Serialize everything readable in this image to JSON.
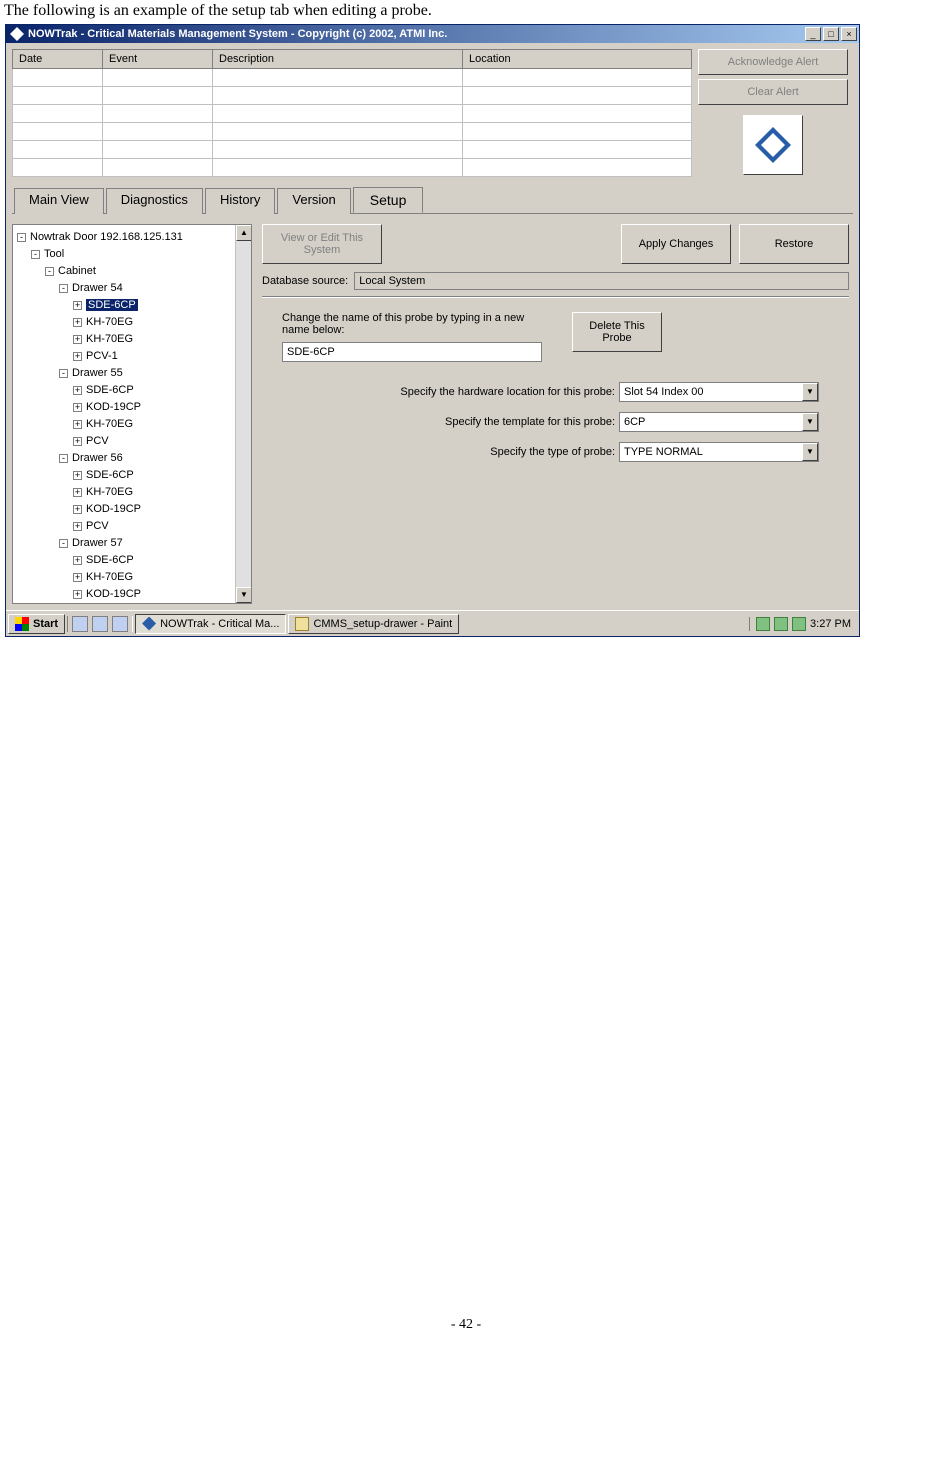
{
  "doc_caption": "The following is an example of the setup tab when editing a probe.",
  "window_title": "NOWTrak - Critical Materials Management System - Copyright (c) 2002, ATMI Inc.",
  "alert_cols": {
    "c1": "Date",
    "c2": "Event",
    "c3": "Description",
    "c4": "Location"
  },
  "side": {
    "ack": "Acknowledge Alert",
    "clear": "Clear Alert"
  },
  "tabs": {
    "t1": "Main View",
    "t2": "Diagnostics",
    "t3": "History",
    "t4": "Version",
    "t5": "Setup"
  },
  "tree": {
    "root": "Nowtrak Door 192.168.125.131",
    "n1": "Tool",
    "n2": "Cabinet",
    "d54": "Drawer 54",
    "d54a": "SDE-6CP",
    "d54b": "KH-70EG",
    "d54c": "KH-70EG",
    "d54d": "PCV-1",
    "d55": "Drawer 55",
    "d55a": "SDE-6CP",
    "d55b": "KOD-19CP",
    "d55c": "KH-70EG",
    "d55d": "PCV",
    "d56": "Drawer 56",
    "d56a": "SDE-6CP",
    "d56b": "KH-70EG",
    "d56c": "KOD-19CP",
    "d56d": "PCV",
    "d57": "Drawer 57",
    "d57a": "SDE-6CP",
    "d57b": "KH-70EG",
    "d57c": "KOD-19CP"
  },
  "buttons": {
    "view_edit": "View or Edit This System",
    "apply": "Apply Changes",
    "restore": "Restore",
    "delete_probe": "Delete This Probe"
  },
  "labels": {
    "db_source": "Database source:",
    "db_value": "Local System",
    "probe_name_prompt": "Change the name of this probe by typing in a new name below:",
    "probe_name_value": "SDE-6CP",
    "hw_loc": "Specify the hardware location for this probe:",
    "hw_loc_val": "Slot 54 Index 00",
    "tmpl": "Specify the template for this probe:",
    "tmpl_val": "6CP",
    "ptype": "Specify the type of probe:",
    "ptype_val": "TYPE NORMAL"
  },
  "taskbar": {
    "start": "Start",
    "task1": "NOWTrak - Critical Ma...",
    "task2": "CMMS_setup-drawer - Paint",
    "clock": "3:27 PM"
  },
  "page_num": "- 42 -"
}
